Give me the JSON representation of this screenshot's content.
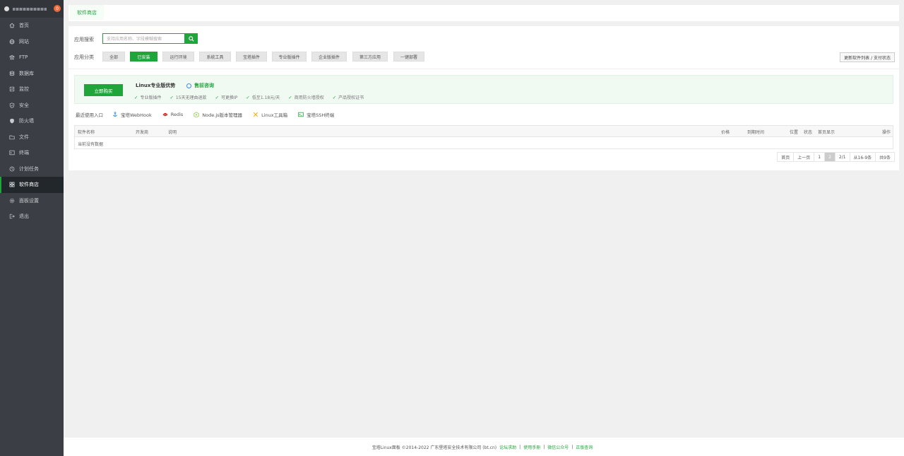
{
  "sidebar": {
    "badge": "0",
    "items": [
      {
        "label": "首页",
        "icon": "home-icon"
      },
      {
        "label": "网站",
        "icon": "globe-icon"
      },
      {
        "label": "FTP",
        "icon": "ftp-icon"
      },
      {
        "label": "数据库",
        "icon": "database-icon"
      },
      {
        "label": "监控",
        "icon": "monitor-icon"
      },
      {
        "label": "安全",
        "icon": "shield-icon"
      },
      {
        "label": "防火墙",
        "icon": "firewall-icon"
      },
      {
        "label": "文件",
        "icon": "folder-icon"
      },
      {
        "label": "终端",
        "icon": "terminal-icon"
      },
      {
        "label": "计划任务",
        "icon": "clock-icon"
      },
      {
        "label": "软件商店",
        "icon": "grid-icon"
      },
      {
        "label": "面板设置",
        "icon": "gear-icon"
      },
      {
        "label": "退出",
        "icon": "logout-icon"
      }
    ],
    "active_index": 10
  },
  "tabs": {
    "store": "软件商店"
  },
  "search": {
    "label": "应用搜索",
    "placeholder": "支持应用名称、字段模糊搜索"
  },
  "category": {
    "label": "应用分类",
    "buttons": [
      "全部",
      "已安装",
      "运行环境",
      "系统工具",
      "宝塔插件",
      "专业版插件",
      "企业版插件",
      "第三方应用",
      "一键部署"
    ],
    "active": "已安装",
    "update_button": "更新软件列表 / 支付状态"
  },
  "promo": {
    "buy": "立即购买",
    "title": "Linux专业版优势",
    "consult": "售前咨询",
    "perks": [
      "专业版插件",
      "15天无理由退款",
      "可更换IP",
      "低至1.18元/天",
      "商用防火墙授权",
      "产品授权证书"
    ]
  },
  "recent": {
    "label": "最近使用入口",
    "items": [
      "宝塔WebHook",
      "Redis",
      "Node.js版本管理器",
      "Linux工具箱",
      "宝塔SSH终端"
    ]
  },
  "table": {
    "headers": {
      "name": "软件名称",
      "dev": "开发商",
      "desc": "说明",
      "price": "价格",
      "expire": "到期时间",
      "location": "位置",
      "status": "状态",
      "home": "首页显示",
      "action": "操作"
    },
    "empty": "当前没有数据"
  },
  "pager": {
    "first": "首页",
    "prev": "上一页",
    "p1": "1",
    "p2": "2",
    "total_pages": "2/1",
    "range": "从16-9条",
    "count": "共9条"
  },
  "footer": {
    "copyright": "宝塔Linux面板 ©2014-2022 广东堡塔安全技术有限公司 (bt.cn)",
    "links": [
      "论坛求助",
      "使用手册",
      "微信公众号",
      "正版查询"
    ]
  },
  "colors": {
    "accent": "#20a53a",
    "sidebar_bg": "#3b3f45",
    "sidebar_active": "#22272b"
  }
}
